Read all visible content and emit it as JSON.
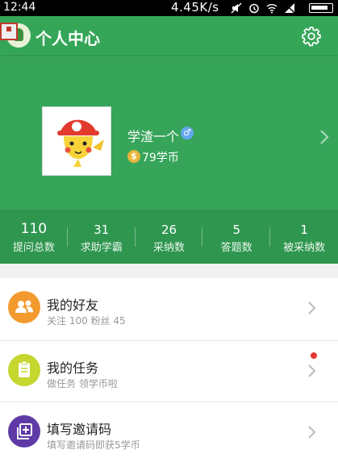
{
  "status_bar": {
    "time": "12:44",
    "speed": "4.45K/s"
  },
  "title_bar": {
    "title": "个人中心"
  },
  "profile": {
    "username": "学渣一个",
    "gender": "♂",
    "coin_symbol": "$",
    "coins": "79学币"
  },
  "stats": [
    {
      "value": "110",
      "label": "提问总数"
    },
    {
      "value": "31",
      "label": "求助学霸"
    },
    {
      "value": "26",
      "label": "采纳数"
    },
    {
      "value": "5",
      "label": "答题数"
    },
    {
      "value": "1",
      "label": "被采纳数"
    }
  ],
  "menu": [
    {
      "title": "我的好友",
      "subtitle": "关注 100  粉丝 45",
      "icon": "friends-icon",
      "color": "#f29a2e"
    },
    {
      "title": "我的任务",
      "subtitle": "做任务 领学币啦",
      "icon": "task-icon",
      "color": "#c5d62e",
      "has_badge": true
    },
    {
      "title": "填写邀请码",
      "subtitle": "填写邀请码即获5学币",
      "icon": "invite-code-icon",
      "color": "#5f3aa6"
    }
  ],
  "colors": {
    "primary": "#35a658",
    "stats_bg": "#2f9650",
    "badge": "#e53935"
  }
}
